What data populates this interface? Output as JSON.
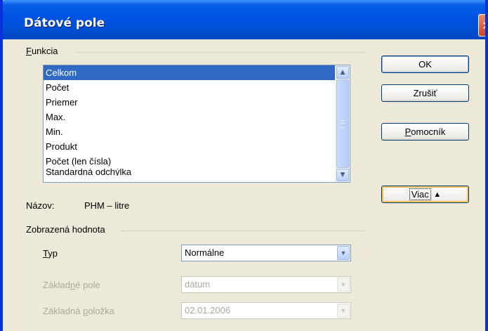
{
  "window": {
    "title": "Dátové pole",
    "close_glyph": "✕"
  },
  "function_group": {
    "label_prefix": "",
    "label_mnemonic": "F",
    "label_rest": "unkcia",
    "items": [
      {
        "label": "Celkom",
        "selected": true
      },
      {
        "label": "Počet",
        "selected": false
      },
      {
        "label": "Priemer",
        "selected": false
      },
      {
        "label": "Max.",
        "selected": false
      },
      {
        "label": "Min.",
        "selected": false
      },
      {
        "label": "Produkt",
        "selected": false
      },
      {
        "label": "Počet (len čísla)",
        "selected": false
      },
      {
        "label": "Štandardná odchýlka",
        "selected": false
      }
    ]
  },
  "name_row": {
    "label": "Názov:",
    "value": "PHM – litre"
  },
  "displayed_value_group": {
    "label": "Zobrazená hodnota",
    "type": {
      "label_mnemonic": "T",
      "label_rest": "yp",
      "value": "Normálne"
    },
    "base_field": {
      "label_before": "Základ",
      "label_mnemonic": "n",
      "label_rest": "é pole",
      "value": "dátum"
    },
    "base_item": {
      "label_before": "Základná ",
      "label_mnemonic": "p",
      "label_rest": "oložka",
      "value": "02.01.2006"
    }
  },
  "buttons": {
    "ok": "OK",
    "cancel": "Zrušiť",
    "help_mnemonic": "P",
    "help_rest": "omocník",
    "more": "Viac",
    "more_icon": "▲"
  },
  "icons": {
    "scroll_up": "▲",
    "scroll_down": "▼",
    "dropdown": "▼"
  }
}
